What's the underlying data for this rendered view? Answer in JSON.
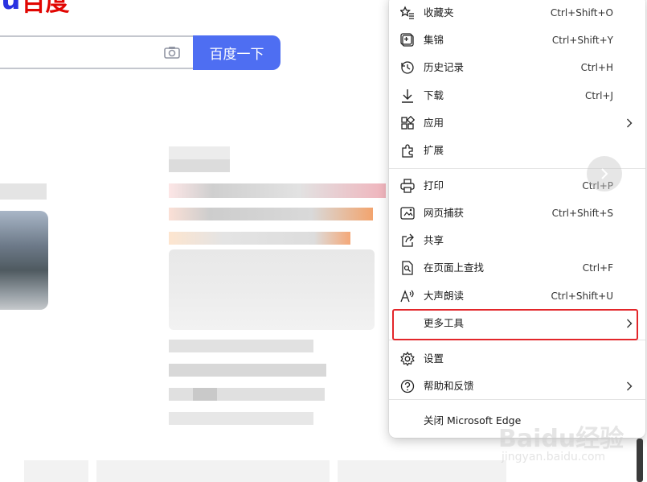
{
  "baidu": {
    "logo_du": "du",
    "logo_cn": "百度",
    "search_button": "百度一下",
    "search_placeholder": ""
  },
  "menu": {
    "items": [
      {
        "label": "收藏夹",
        "shortcut": "Ctrl+Shift+O",
        "icon": "star-list-icon"
      },
      {
        "label": "集锦",
        "shortcut": "Ctrl+Shift+Y",
        "icon": "collections-icon"
      },
      {
        "label": "历史记录",
        "shortcut": "Ctrl+H",
        "icon": "history-icon"
      },
      {
        "label": "下载",
        "shortcut": "Ctrl+J",
        "icon": "download-icon"
      },
      {
        "label": "应用",
        "shortcut": "",
        "icon": "apps-icon"
      },
      {
        "label": "扩展",
        "shortcut": "",
        "icon": "extensions-icon"
      },
      {
        "label": "打印",
        "shortcut": "Ctrl+P",
        "icon": "print-icon"
      },
      {
        "label": "网页捕获",
        "shortcut": "Ctrl+Shift+S",
        "icon": "web-capture-icon"
      },
      {
        "label": "共享",
        "shortcut": "",
        "icon": "share-icon"
      },
      {
        "label": "在页面上查找",
        "shortcut": "Ctrl+F",
        "icon": "find-icon"
      },
      {
        "label": "大声朗读",
        "shortcut": "Ctrl+Shift+U",
        "icon": "read-aloud-icon"
      },
      {
        "label": "更多工具",
        "shortcut": "",
        "icon": ""
      },
      {
        "label": "设置",
        "shortcut": "",
        "icon": "settings-icon"
      },
      {
        "label": "帮助和反馈",
        "shortcut": "",
        "icon": "help-icon"
      },
      {
        "label": "关闭 Microsoft Edge",
        "shortcut": "",
        "icon": ""
      }
    ]
  },
  "watermark": {
    "text": "Baidu经验",
    "url": "jingyan.baidu.com"
  },
  "colors": {
    "accent": "#4e6ef2",
    "highlight": "#e3262a",
    "logo_blue": "#2932e1",
    "logo_red": "#e10602"
  }
}
